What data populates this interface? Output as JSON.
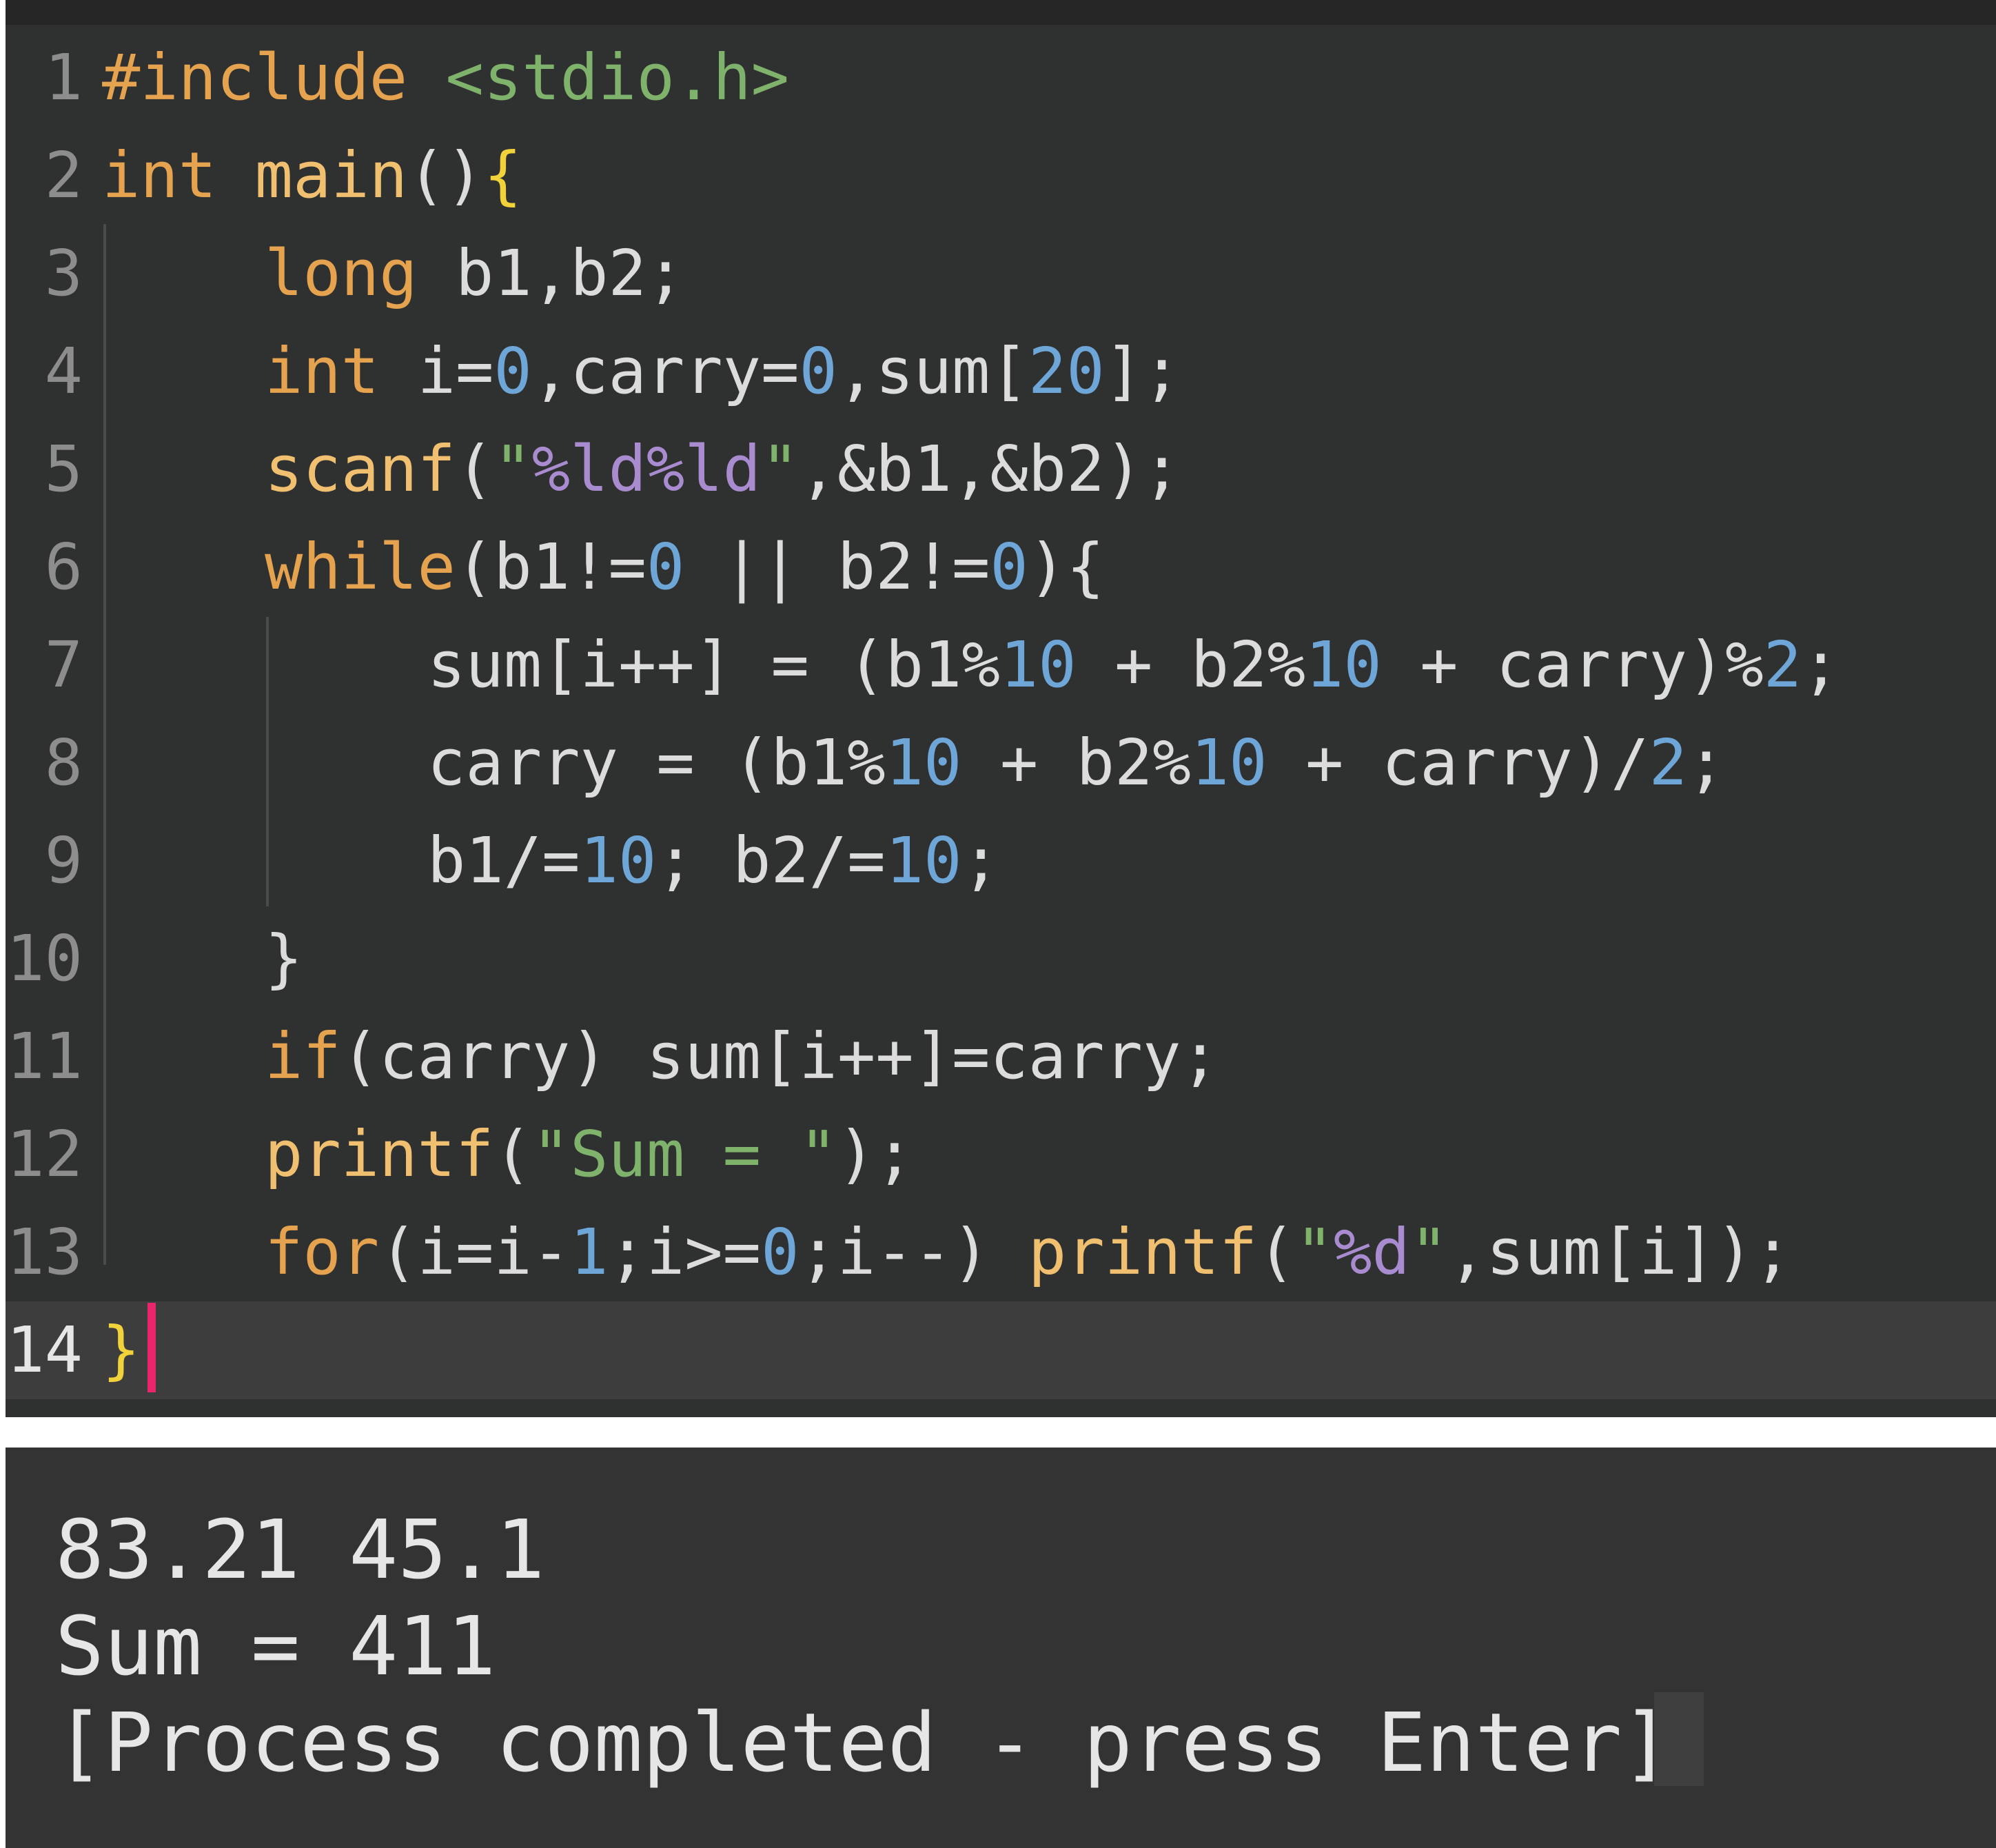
{
  "colors": {
    "editor_bg": "#2f3030",
    "current_line_bg": "#3d3d3d",
    "console_bg": "#333333",
    "default_text": "#dcdcdc",
    "keyword": "#e5a24f",
    "function": "#f0c070",
    "number": "#6ea6d8",
    "string": "#7fb36b",
    "format_spec": "#a98ccf",
    "brace_yellow": "#f2d23a",
    "line_number": "#8d8d8d",
    "caret": "#e8266b"
  },
  "editor": {
    "current_line": 14,
    "lines": [
      {
        "n": "1",
        "indent": 0,
        "tokens": [
          {
            "t": "#include ",
            "c": "keyword"
          },
          {
            "t": "<stdio.h>",
            "c": "string"
          }
        ]
      },
      {
        "n": "2",
        "indent": 0,
        "tokens": [
          {
            "t": "int ",
            "c": "keyword"
          },
          {
            "t": "main",
            "c": "function"
          },
          {
            "t": "()",
            "c": "default_text"
          },
          {
            "t": "{",
            "c": "brace_yellow"
          }
        ]
      },
      {
        "n": "3",
        "indent": 1,
        "tokens": [
          {
            "t": "long ",
            "c": "keyword"
          },
          {
            "t": "b1,b2;",
            "c": "default_text"
          }
        ]
      },
      {
        "n": "4",
        "indent": 1,
        "tokens": [
          {
            "t": "int ",
            "c": "keyword"
          },
          {
            "t": "i=",
            "c": "default_text"
          },
          {
            "t": "0",
            "c": "number"
          },
          {
            "t": ",carry=",
            "c": "default_text"
          },
          {
            "t": "0",
            "c": "number"
          },
          {
            "t": ",sum[",
            "c": "default_text"
          },
          {
            "t": "20",
            "c": "number"
          },
          {
            "t": "];",
            "c": "default_text"
          }
        ]
      },
      {
        "n": "5",
        "indent": 1,
        "tokens": [
          {
            "t": "scanf",
            "c": "function"
          },
          {
            "t": "(",
            "c": "default_text"
          },
          {
            "t": "\"",
            "c": "string"
          },
          {
            "t": "%ld%ld",
            "c": "format_spec"
          },
          {
            "t": "\"",
            "c": "string"
          },
          {
            "t": ",&b1,&b2);",
            "c": "default_text"
          }
        ]
      },
      {
        "n": "6",
        "indent": 1,
        "tokens": [
          {
            "t": "while",
            "c": "keyword"
          },
          {
            "t": "(b1!=",
            "c": "default_text"
          },
          {
            "t": "0",
            "c": "number"
          },
          {
            "t": " || b2!=",
            "c": "default_text"
          },
          {
            "t": "0",
            "c": "number"
          },
          {
            "t": "){",
            "c": "default_text"
          }
        ]
      },
      {
        "n": "7",
        "indent": 2,
        "tokens": [
          {
            "t": "sum[i++] = (b1%",
            "c": "default_text"
          },
          {
            "t": "10",
            "c": "number"
          },
          {
            "t": " + b2%",
            "c": "default_text"
          },
          {
            "t": "10",
            "c": "number"
          },
          {
            "t": " + carry)%",
            "c": "default_text"
          },
          {
            "t": "2",
            "c": "number"
          },
          {
            "t": ";",
            "c": "default_text"
          }
        ]
      },
      {
        "n": "8",
        "indent": 2,
        "tokens": [
          {
            "t": "carry = (b1%",
            "c": "default_text"
          },
          {
            "t": "10",
            "c": "number"
          },
          {
            "t": " + b2%",
            "c": "default_text"
          },
          {
            "t": "10",
            "c": "number"
          },
          {
            "t": " + carry)/",
            "c": "default_text"
          },
          {
            "t": "2",
            "c": "number"
          },
          {
            "t": ";",
            "c": "default_text"
          }
        ]
      },
      {
        "n": "9",
        "indent": 2,
        "tokens": [
          {
            "t": "b1/=",
            "c": "default_text"
          },
          {
            "t": "10",
            "c": "number"
          },
          {
            "t": "; b2/=",
            "c": "default_text"
          },
          {
            "t": "10",
            "c": "number"
          },
          {
            "t": ";",
            "c": "default_text"
          }
        ]
      },
      {
        "n": "10",
        "indent": 1,
        "tokens": [
          {
            "t": "}",
            "c": "default_text"
          }
        ]
      },
      {
        "n": "11",
        "indent": 1,
        "tokens": [
          {
            "t": "if",
            "c": "keyword"
          },
          {
            "t": "(carry) sum[i++]=carry;",
            "c": "default_text"
          }
        ]
      },
      {
        "n": "12",
        "indent": 1,
        "tokens": [
          {
            "t": "printf",
            "c": "function"
          },
          {
            "t": "(",
            "c": "default_text"
          },
          {
            "t": "\"Sum = \"",
            "c": "string"
          },
          {
            "t": ");",
            "c": "default_text"
          }
        ]
      },
      {
        "n": "13",
        "indent": 1,
        "tokens": [
          {
            "t": "for",
            "c": "keyword"
          },
          {
            "t": "(i=i-",
            "c": "default_text"
          },
          {
            "t": "1",
            "c": "number"
          },
          {
            "t": ";i>=",
            "c": "default_text"
          },
          {
            "t": "0",
            "c": "number"
          },
          {
            "t": ";i--) ",
            "c": "default_text"
          },
          {
            "t": "printf",
            "c": "function"
          },
          {
            "t": "(",
            "c": "default_text"
          },
          {
            "t": "\"",
            "c": "string"
          },
          {
            "t": "%d",
            "c": "format_spec"
          },
          {
            "t": "\"",
            "c": "string"
          },
          {
            "t": ",sum[i]);",
            "c": "default_text"
          }
        ]
      },
      {
        "n": "14",
        "indent": 0,
        "tokens": [
          {
            "t": "}",
            "c": "brace_yellow"
          }
        ]
      }
    ]
  },
  "console": {
    "lines": [
      "83.21 45.1",
      "Sum = 411",
      "[Process completed - press Enter]"
    ]
  }
}
